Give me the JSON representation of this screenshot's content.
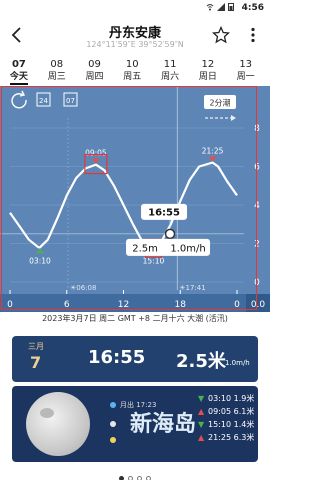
{
  "status": {
    "time": "4:56"
  },
  "header": {
    "title": "丹东安康",
    "coords": "124°11′59″E  39°52′59″N"
  },
  "days": [
    {
      "num": "07",
      "week": "今天",
      "selected": true
    },
    {
      "num": "08",
      "week": "周三"
    },
    {
      "num": "09",
      "week": "周四"
    },
    {
      "num": "10",
      "week": "周五"
    },
    {
      "num": "11",
      "week": "周六"
    },
    {
      "num": "12",
      "week": "周日"
    },
    {
      "num": "13",
      "week": "周一"
    }
  ],
  "chart": {
    "interval_label": "2分潮",
    "icon_days_24": "24",
    "icon_days_07": "07",
    "cursor_time": "16:55",
    "cursor_height": "2.5m",
    "cursor_speed": "1.0m/h",
    "sunrise": "☀06:08",
    "sunset": "☀17:41",
    "unit_right": "0.0",
    "extremes": [
      {
        "time": "03:10",
        "label": "03:10"
      },
      {
        "time": "09:05",
        "label": "09:05"
      },
      {
        "time": "15:10",
        "label": "15:10"
      },
      {
        "time": "21:25",
        "label": "21:25"
      }
    ]
  },
  "chart_data": {
    "type": "line",
    "x": [
      0,
      1,
      2,
      3,
      3.17,
      4,
      5,
      6,
      7,
      8,
      9.08,
      10,
      11,
      12,
      13,
      14,
      15.17,
      16,
      17,
      18,
      19,
      20,
      21.42,
      22,
      23,
      24
    ],
    "series": [
      {
        "values": [
          3.6,
          2.9,
          2.2,
          1.8,
          1.8,
          2.2,
          3.3,
          4.5,
          5.4,
          5.9,
          6.1,
          5.8,
          5.0,
          4.0,
          3.0,
          2.1,
          1.8,
          2.1,
          3.0,
          4.2,
          5.3,
          6.0,
          6.2,
          6.0,
          5.2,
          4.5
        ]
      }
    ],
    "xlim": [
      0,
      24
    ],
    "ylim": [
      0,
      8
    ],
    "xticks": [
      "0",
      "6",
      "12",
      "18",
      "0"
    ],
    "yticks": [
      "0",
      "2",
      "4",
      "6",
      "8"
    ],
    "grid": true
  },
  "date_line": "2023年3月7日 周二 GMT +8 二月十六 大潮 (活汛)",
  "info": {
    "month": "三月",
    "day": "7",
    "time": "16:55",
    "height": "2.5米",
    "speed": "1.0m/h"
  },
  "moon": {
    "moonrise": "月出 17:23",
    "brand": "新海岛"
  },
  "tides": [
    {
      "time": "03:10",
      "height": "1.9米",
      "dir": "down",
      "color": "#4caf50"
    },
    {
      "time": "09:05",
      "height": "6.1米",
      "dir": "up",
      "color": "#e05050"
    },
    {
      "time": "15:10",
      "height": "1.4米",
      "dir": "down",
      "color": "#4caf50"
    },
    {
      "time": "21:25",
      "height": "6.3米",
      "dir": "up",
      "color": "#e05050"
    }
  ]
}
